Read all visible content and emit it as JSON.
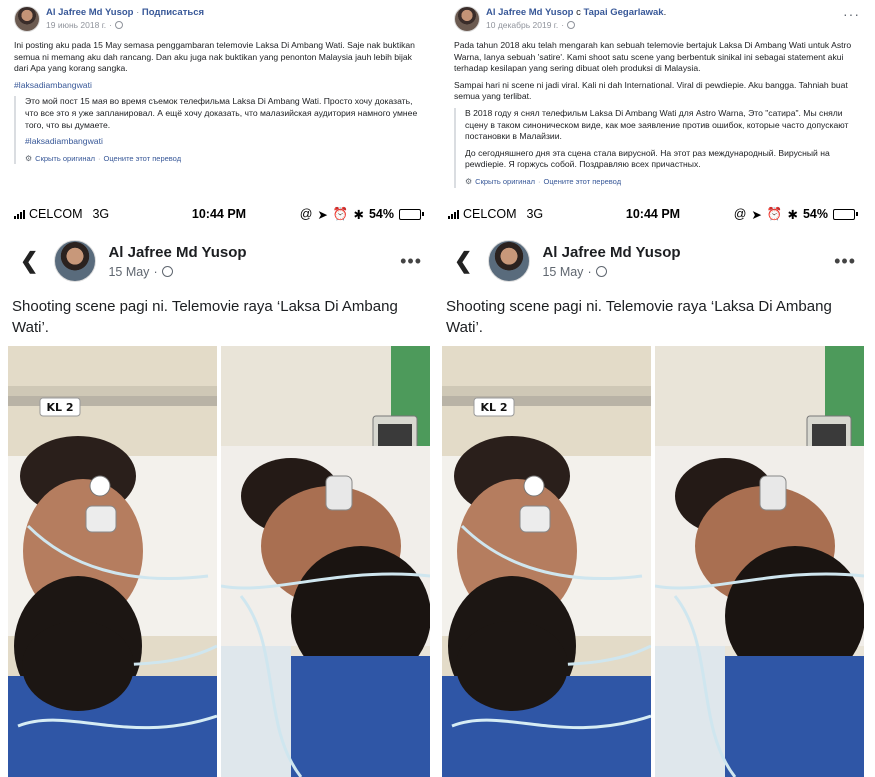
{
  "left": {
    "author": "Al Jafree Md Yusop",
    "separator": "·",
    "follow": "Подписаться",
    "date": "19 июнь 2018 г.",
    "privacy_sep": "·",
    "original_text": "Ini posting aku pada 15 May semasa penggambaran telemovie Laksa Di Ambang Wati. Saje nak buktikan semua ni memang aku dah rancang. Dan aku juga nak buktikan yang penonton Malaysia jauh lebih bijak dari Apa yang korang sangka.",
    "hashtag": "#laksadiambangwati",
    "translation_text": "Это мой пост 15 мая во время съемок телефильма Laksa Di Ambang Wati. Просто хочу доказать, что все это я уже запланировал. А ещё хочу доказать, что малазийская аудитория намного умнее того, что вы думаете.",
    "translation_hashtag": "#laksadiambangwati",
    "hide_original": "Скрыть оригинал",
    "link_sep": "·",
    "rate_translation": "Оцените этот перевод"
  },
  "right": {
    "author": "Al Jafree Md Yusop",
    "with_text": "с",
    "tagged": "Tapai Gegarlawak",
    "tagged_end": ".",
    "date": "10 декабрь 2019 г.",
    "privacy_sep": "·",
    "more": "···",
    "original_p1": "Pada tahun 2018 aku telah mengarah kan sebuah telemovie bertajuk Laksa Di Ambang Wati untuk Astro Warna, Ianya sebuah 'satire'. Kami shoot satu scene yang berbentuk sinikal ini sebagai statement akui terhadap kesilapan yang sering dibuat oleh produksi di Malaysia.",
    "original_p2": "Sampai hari ni scene ni jadi viral. Kali ni dah International. Viral di pewdiepie. Aku bangga. Tahniah buat semua yang terlibat.",
    "translation_p1": "В 2018 году я снял телефильм Laksa Di Ambang Wati для Astro Warna, Это \"сатира\". Мы сняли сцену в таком синоническом виде, как мое заявление против ошибок, которые часто допускают постановки в Малайзии.",
    "translation_p2": "До сегодняшнего дня эта сцена стала вирусной. На этот раз международный. Вирусный на pewdiepie. Я горжусь собой. Поздравляю всех причастных.",
    "hide_original": "Скрыть оригинал",
    "link_sep": "·",
    "rate_translation": "Оцените этот перевод"
  },
  "phone": {
    "carrier": "CELCOM",
    "network": "3G",
    "time": "10:44 PM",
    "battery_text": "54%",
    "battery_level": 0.54,
    "status_icons": [
      "@",
      "➤",
      "⏰",
      "✱"
    ],
    "author": "Al Jafree Md Yusop",
    "date": "15 May",
    "privacy_sep": "·",
    "more": "•••",
    "caption": "Shooting scene pagi ni. Telemovie raya ‘Laksa Di Ambang Wati’.",
    "bed_label": "KL 2",
    "colors": {
      "battery": "#f5c400",
      "gown": "#2f56a6",
      "wall": "#e6decb"
    }
  },
  "icons": {
    "back": "chevron-left-icon",
    "globe": "globe-icon",
    "gear": "gear-icon",
    "more": "more-dots-icon"
  },
  "colors": {
    "link": "#385898",
    "meta": "#90949c",
    "text": "#1c1e21"
  }
}
